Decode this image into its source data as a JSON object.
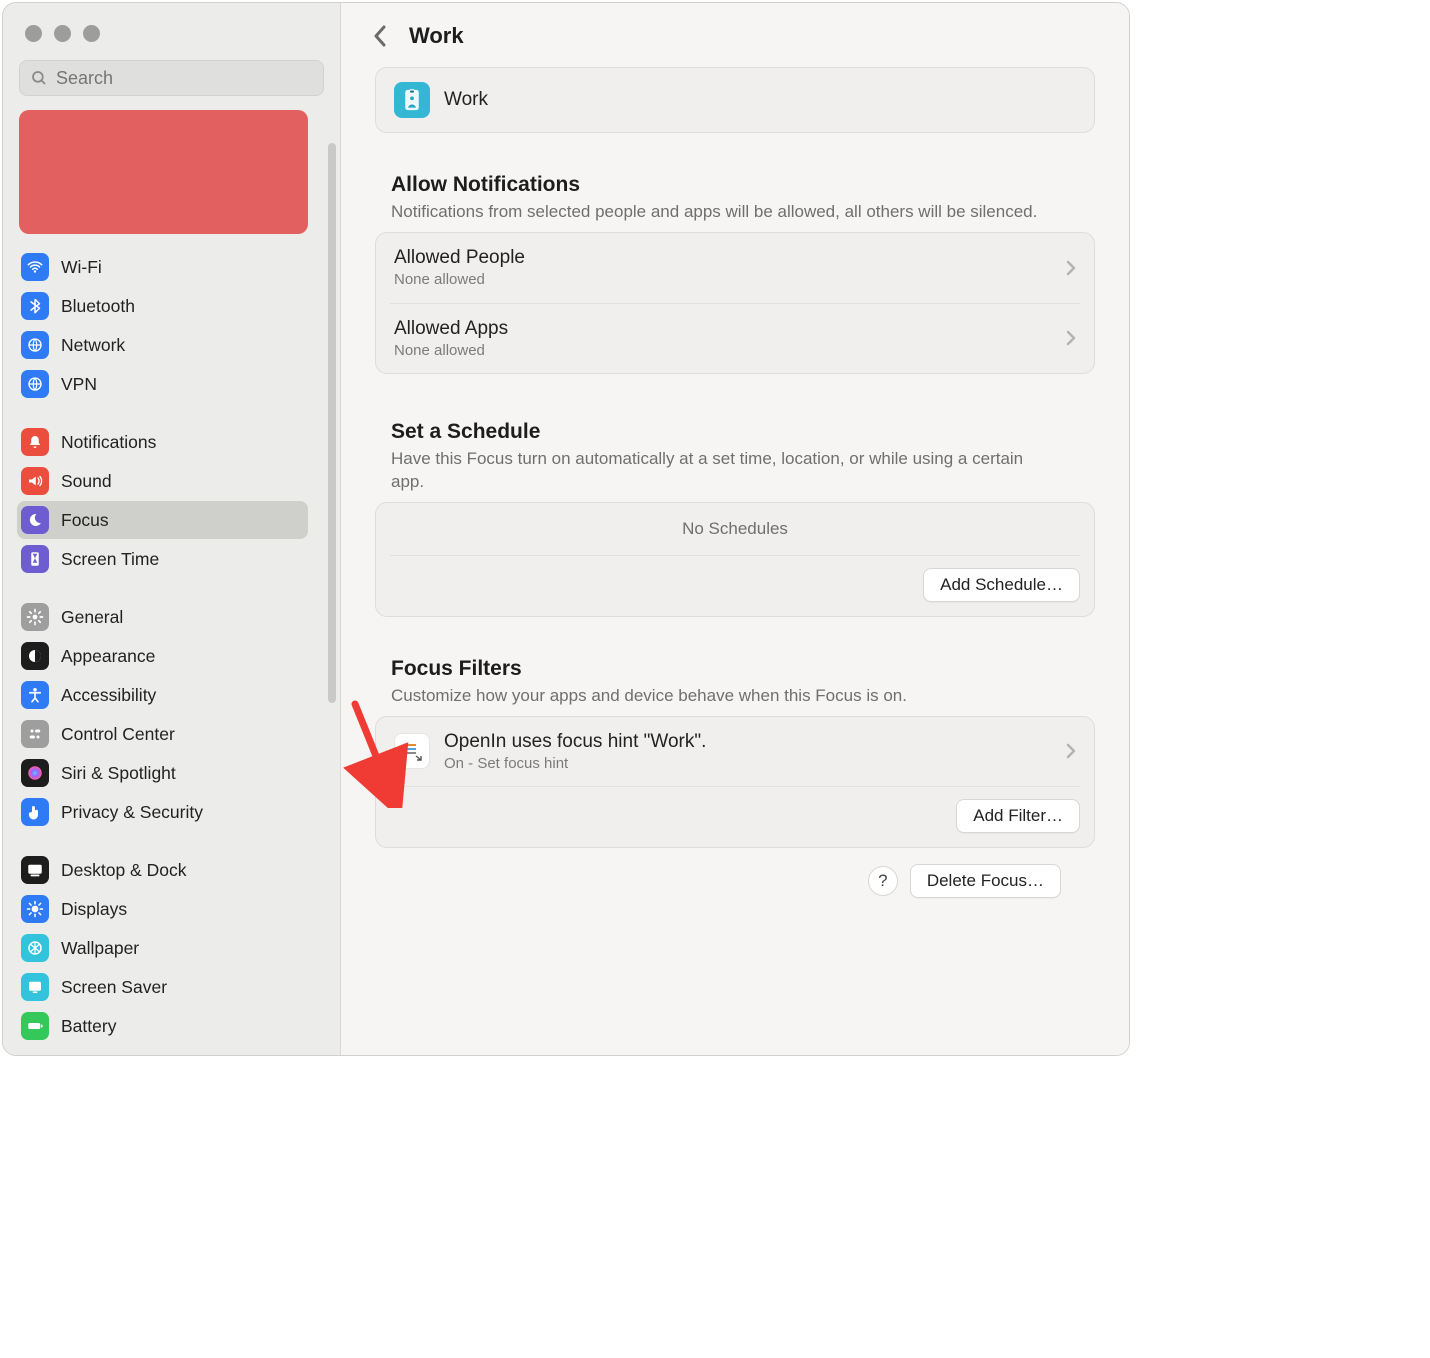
{
  "window": {
    "title": "Work",
    "search_placeholder": "Search"
  },
  "sidebar": {
    "groups": [
      [
        {
          "label": "Wi-Fi",
          "icon": "wifi",
          "color": "#2f7bf6"
        },
        {
          "label": "Bluetooth",
          "icon": "bt",
          "color": "#2f7bf6"
        },
        {
          "label": "Network",
          "icon": "globe",
          "color": "#2f7bf6"
        },
        {
          "label": "VPN",
          "icon": "globe",
          "color": "#2f7bf6"
        }
      ],
      [
        {
          "label": "Notifications",
          "icon": "bell",
          "color": "#eb4e3d"
        },
        {
          "label": "Sound",
          "icon": "sound",
          "color": "#eb4e3d"
        },
        {
          "label": "Focus",
          "icon": "moon",
          "color": "#6e5dd1",
          "selected": true
        },
        {
          "label": "Screen Time",
          "icon": "hour",
          "color": "#6e5dd1"
        }
      ],
      [
        {
          "label": "General",
          "icon": "gear",
          "color": "#9e9e9e"
        },
        {
          "label": "Appearance",
          "icon": "appear",
          "color": "#1d1d1d"
        },
        {
          "label": "Accessibility",
          "icon": "acc",
          "color": "#2f7bf6"
        },
        {
          "label": "Control Center",
          "icon": "cc",
          "color": "#9e9e9e"
        },
        {
          "label": "Siri & Spotlight",
          "icon": "siri",
          "color": "#1d1d1d"
        },
        {
          "label": "Privacy & Security",
          "icon": "hand",
          "color": "#2f7bf6"
        }
      ],
      [
        {
          "label": "Desktop & Dock",
          "icon": "dock",
          "color": "#1d1d1d"
        },
        {
          "label": "Displays",
          "icon": "disp",
          "color": "#2f7bf6"
        },
        {
          "label": "Wallpaper",
          "icon": "wall",
          "color": "#34c3dc"
        },
        {
          "label": "Screen Saver",
          "icon": "ss",
          "color": "#34c3dc"
        },
        {
          "label": "Battery",
          "icon": "batt",
          "color": "#34c759"
        }
      ]
    ]
  },
  "focus": {
    "name": "Work"
  },
  "sections": {
    "notifications": {
      "title": "Allow Notifications",
      "desc": "Notifications from selected people and apps will be allowed, all others will be silenced.",
      "rows": [
        {
          "title": "Allowed People",
          "sub": "None allowed"
        },
        {
          "title": "Allowed Apps",
          "sub": "None allowed"
        }
      ]
    },
    "schedule": {
      "title": "Set a Schedule",
      "desc": "Have this Focus turn on automatically at a set time, location, or while using a certain app.",
      "empty": "No Schedules",
      "add_button": "Add Schedule…"
    },
    "filters": {
      "title": "Focus Filters",
      "desc": "Customize how your apps and device behave when this Focus is on.",
      "item_title": "OpenIn uses focus hint \"Work\".",
      "item_sub": "On - Set focus hint",
      "add_button": "Add Filter…"
    }
  },
  "footer": {
    "help": "?",
    "delete": "Delete Focus…"
  }
}
